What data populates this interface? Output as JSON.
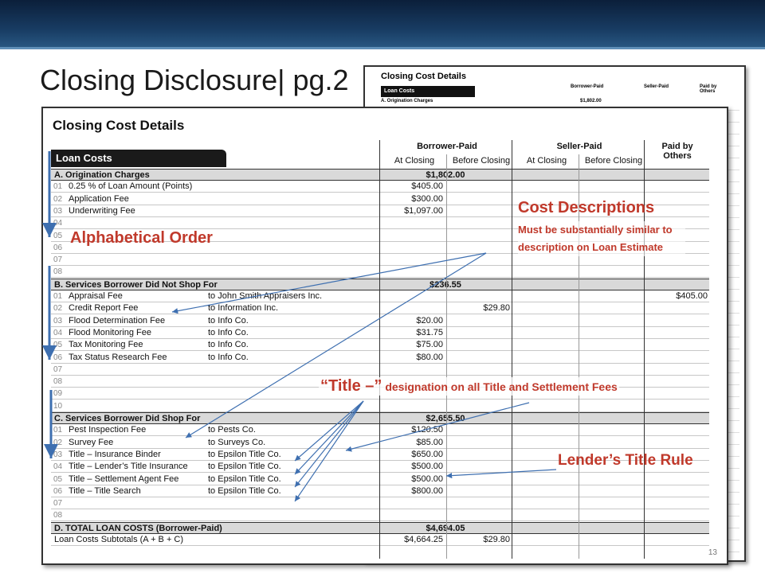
{
  "slide": {
    "title": "Closing Disclosure| pg.2",
    "page_number": "13"
  },
  "background_doc": {
    "title": "Closing Cost Details",
    "loan_costs": "Loan Costs",
    "borrower_paid": "Borrower-Paid",
    "seller_paid": "Seller-Paid",
    "paid_by_others": "Paid by Others",
    "section_a": "A. Origination Charges",
    "section_a_amount": "$1,802.00"
  },
  "doc": {
    "title": "Closing Cost Details",
    "loan_costs_label": "Loan Costs",
    "columns": {
      "borrower_paid": "Borrower-Paid",
      "seller_paid": "Seller-Paid",
      "paid_by_others_1": "Paid by",
      "paid_by_others_2": "Others",
      "at_closing": "At Closing",
      "before_closing": "Before Closing"
    },
    "section_a": {
      "label": "A.  Origination Charges",
      "amount": "$1,802.00",
      "rows": [
        {
          "num": "01",
          "desc": "0.25  % of Loan Amount (Points)",
          "to": "",
          "bat": "$405.00",
          "bbc": "",
          "sat": "",
          "others": ""
        },
        {
          "num": "02",
          "desc": "Application Fee",
          "to": "",
          "bat": "$300.00",
          "bbc": "",
          "sat": "",
          "others": ""
        },
        {
          "num": "03",
          "desc": "Underwriting Fee",
          "to": "",
          "bat": "$1,097.00",
          "bbc": "",
          "sat": "",
          "others": ""
        },
        {
          "num": "04",
          "desc": "",
          "to": "",
          "bat": "",
          "bbc": "",
          "sat": "",
          "others": ""
        },
        {
          "num": "05",
          "desc": "",
          "to": "",
          "bat": "",
          "bbc": "",
          "sat": "",
          "others": ""
        },
        {
          "num": "06",
          "desc": "",
          "to": "",
          "bat": "",
          "bbc": "",
          "sat": "",
          "others": ""
        },
        {
          "num": "07",
          "desc": "",
          "to": "",
          "bat": "",
          "bbc": "",
          "sat": "",
          "others": ""
        },
        {
          "num": "08",
          "desc": "",
          "to": "",
          "bat": "",
          "bbc": "",
          "sat": "",
          "others": ""
        }
      ]
    },
    "section_b": {
      "label": "B.  Services Borrower Did Not Shop For",
      "amount": "$236.55",
      "rows": [
        {
          "num": "01",
          "desc": "Appraisal Fee",
          "to": "to  John Smith Appraisers Inc.",
          "bat": "",
          "bbc": "",
          "sat": "",
          "others": "$405.00"
        },
        {
          "num": "02",
          "desc": "Credit Report Fee",
          "to": "to  Information Inc.",
          "bat": "",
          "bbc": "$29.80",
          "sat": "",
          "others": ""
        },
        {
          "num": "03",
          "desc": "Flood Determination Fee",
          "to": "to  Info Co.",
          "bat": "$20.00",
          "bbc": "",
          "sat": "",
          "others": ""
        },
        {
          "num": "04",
          "desc": "Flood Monitoring Fee",
          "to": "to  Info Co.",
          "bat": "$31.75",
          "bbc": "",
          "sat": "",
          "others": ""
        },
        {
          "num": "05",
          "desc": "Tax Monitoring Fee",
          "to": "to  Info Co.",
          "bat": "$75.00",
          "bbc": "",
          "sat": "",
          "others": ""
        },
        {
          "num": "06",
          "desc": "Tax Status Research Fee",
          "to": "to  Info Co.",
          "bat": "$80.00",
          "bbc": "",
          "sat": "",
          "others": ""
        },
        {
          "num": "07",
          "desc": "",
          "to": "",
          "bat": "",
          "bbc": "",
          "sat": "",
          "others": ""
        },
        {
          "num": "08",
          "desc": "",
          "to": "",
          "bat": "",
          "bbc": "",
          "sat": "",
          "others": ""
        },
        {
          "num": "09",
          "desc": "",
          "to": "",
          "bat": "",
          "bbc": "",
          "sat": "",
          "others": ""
        },
        {
          "num": "10",
          "desc": "",
          "to": "",
          "bat": "",
          "bbc": "",
          "sat": "",
          "others": ""
        }
      ]
    },
    "section_c": {
      "label": "C.  Services Borrower Did Shop For",
      "amount": "$2,655.50",
      "rows": [
        {
          "num": "01",
          "desc": "Pest Inspection Fee",
          "to": "to  Pests Co.",
          "bat": "$120.50",
          "bbc": "",
          "sat": "",
          "others": ""
        },
        {
          "num": "02",
          "desc": "Survey Fee",
          "to": "to  Surveys Co.",
          "bat": "$85.00",
          "bbc": "",
          "sat": "",
          "others": ""
        },
        {
          "num": "03",
          "desc": "Title – Insurance Binder",
          "to": "to  Epsilon Title Co.",
          "bat": "$650.00",
          "bbc": "",
          "sat": "",
          "others": ""
        },
        {
          "num": "04",
          "desc": "Title – Lender’s Title Insurance",
          "to": "to  Epsilon Title Co.",
          "bat": "$500.00",
          "bbc": "",
          "sat": "",
          "others": ""
        },
        {
          "num": "05",
          "desc": "Title – Settlement Agent Fee",
          "to": "to  Epsilon Title Co.",
          "bat": "$500.00",
          "bbc": "",
          "sat": "",
          "others": ""
        },
        {
          "num": "06",
          "desc": "Title – Title Search",
          "to": "to  Epsilon Title Co.",
          "bat": "$800.00",
          "bbc": "",
          "sat": "",
          "others": ""
        },
        {
          "num": "07",
          "desc": "",
          "to": "",
          "bat": "",
          "bbc": "",
          "sat": "",
          "others": ""
        },
        {
          "num": "08",
          "desc": "",
          "to": "",
          "bat": "",
          "bbc": "",
          "sat": "",
          "others": ""
        }
      ]
    },
    "section_d": {
      "label": "D. TOTAL LOAN COSTS (Borrower-Paid)",
      "amount": "$4,694.05"
    },
    "subtotals": {
      "label": "Loan Costs Subtotals (A + B + C)",
      "bat": "$4,664.25",
      "bbc": "$29.80"
    }
  },
  "annotations": {
    "alphabetical": "Alphabetical Order",
    "cost_desc_title": "Cost Descriptions",
    "cost_desc_body": "Must be substantially similar to description on Loan Estimate",
    "title_quote": "“Title –”",
    "title_rest": " designation on all Title and Settlement Fees",
    "lender_rule": "Lender’s Title Rule"
  },
  "colors": {
    "annotation_text": "#c0392b",
    "arrow": "#3e6fb0",
    "header_band": "#0b1f3a"
  }
}
